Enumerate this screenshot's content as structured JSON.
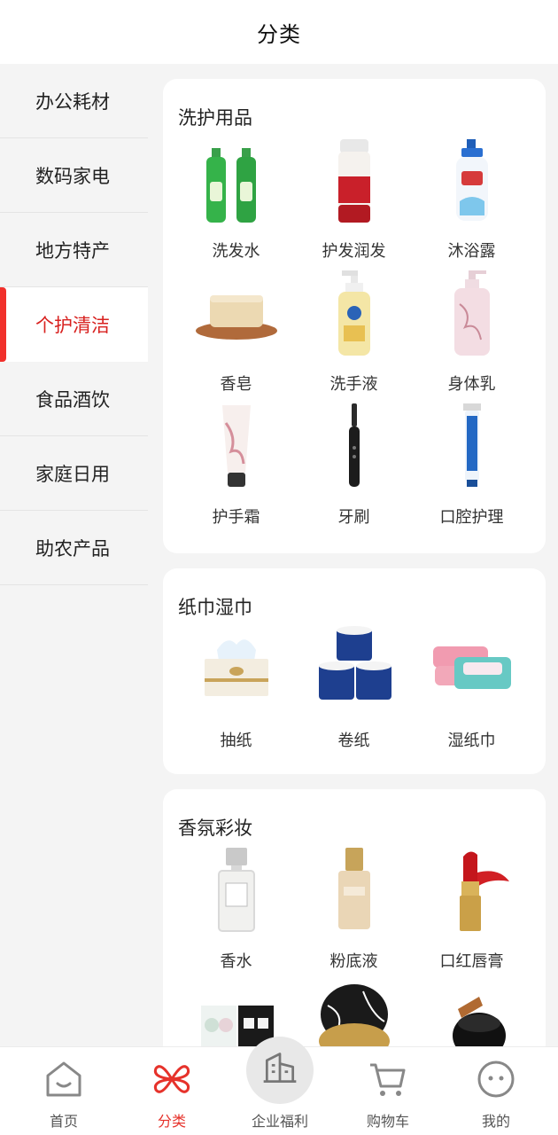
{
  "header": {
    "title": "分类"
  },
  "sidebar": {
    "items": [
      {
        "label": "办公耗材"
      },
      {
        "label": "数码家电"
      },
      {
        "label": "地方特产"
      },
      {
        "label": "个护清洁"
      },
      {
        "label": "食品酒饮"
      },
      {
        "label": "家庭日用"
      },
      {
        "label": "助农产品"
      }
    ]
  },
  "sections": [
    {
      "title": "洗护用品",
      "items": [
        {
          "label": "洗发水",
          "icon": "shampoo-bottles-icon"
        },
        {
          "label": "护发润发",
          "icon": "conditioner-bottle-icon"
        },
        {
          "label": "沐浴露",
          "icon": "shower-gel-bottle-icon"
        },
        {
          "label": "香皂",
          "icon": "soap-bar-icon"
        },
        {
          "label": "洗手液",
          "icon": "hand-wash-pump-icon"
        },
        {
          "label": "身体乳",
          "icon": "body-lotion-bottle-icon"
        },
        {
          "label": "护手霜",
          "icon": "hand-cream-tube-icon"
        },
        {
          "label": "牙刷",
          "icon": "electric-toothbrush-icon"
        },
        {
          "label": "口腔护理",
          "icon": "toothpaste-tube-icon"
        }
      ]
    },
    {
      "title": "纸巾湿巾",
      "items": [
        {
          "label": "抽纸",
          "icon": "tissue-box-icon"
        },
        {
          "label": "卷纸",
          "icon": "toilet-roll-icon"
        },
        {
          "label": "湿纸巾",
          "icon": "wet-wipes-pack-icon"
        }
      ]
    },
    {
      "title": "香氛彩妆",
      "items": [
        {
          "label": "香水",
          "icon": "perfume-bottle-icon"
        },
        {
          "label": "粉底液",
          "icon": "foundation-bottle-icon"
        },
        {
          "label": "口红唇膏",
          "icon": "lipstick-icon"
        },
        {
          "label": "",
          "icon": "eyeshadow-palette-icon"
        },
        {
          "label": "",
          "icon": "cushion-compact-icon"
        },
        {
          "label": "",
          "icon": "makeup-brush-icon"
        }
      ]
    }
  ],
  "tabbar": {
    "items": [
      {
        "label": "首页",
        "icon": "home-icon"
      },
      {
        "label": "分类",
        "icon": "category-icon"
      },
      {
        "label": "企业福利",
        "icon": "building-icon"
      },
      {
        "label": "购物车",
        "icon": "cart-icon"
      },
      {
        "label": "我的",
        "icon": "profile-icon"
      }
    ]
  },
  "colors": {
    "accent": "#e6322b",
    "active_bar": "#f1302b",
    "background": "#f4f4f4"
  }
}
